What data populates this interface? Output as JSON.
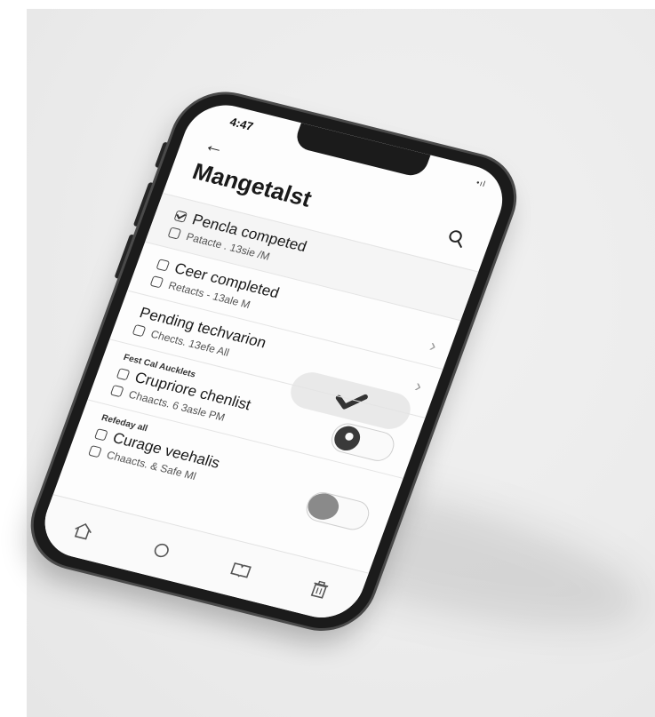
{
  "status": {
    "time": "4:47",
    "signal": "•ıl"
  },
  "header": {
    "title": "Mangetalst"
  },
  "items": [
    {
      "title": "Pencla competed",
      "subtitle": "Patacte . 13sie /M",
      "checked": true
    },
    {
      "title": "Ceer completed",
      "subtitle": "Retacts - 13ale M",
      "checked": false
    },
    {
      "title": "Pending techvarion",
      "subtitle": "Chects. 13efe All",
      "checked": false
    },
    {
      "section": "Fest Cal Aucklets",
      "title": "Crupriore chenlist",
      "subtitle": "Chaacts. 6 3asle PM",
      "checked": false
    },
    {
      "section": "Refeday all",
      "title": "Curage veehalis",
      "subtitle": "Chaacts. & Safe Ml",
      "checked": false
    }
  ],
  "icons": {
    "back": "back-arrow-icon",
    "search": "search-icon",
    "nav": [
      "home-icon",
      "circle-icon",
      "book-icon",
      "trash-icon"
    ]
  },
  "colors": {
    "screen": "#fdfdfd",
    "frame": "#1b1b1b",
    "accent": "#3a3a3a"
  }
}
